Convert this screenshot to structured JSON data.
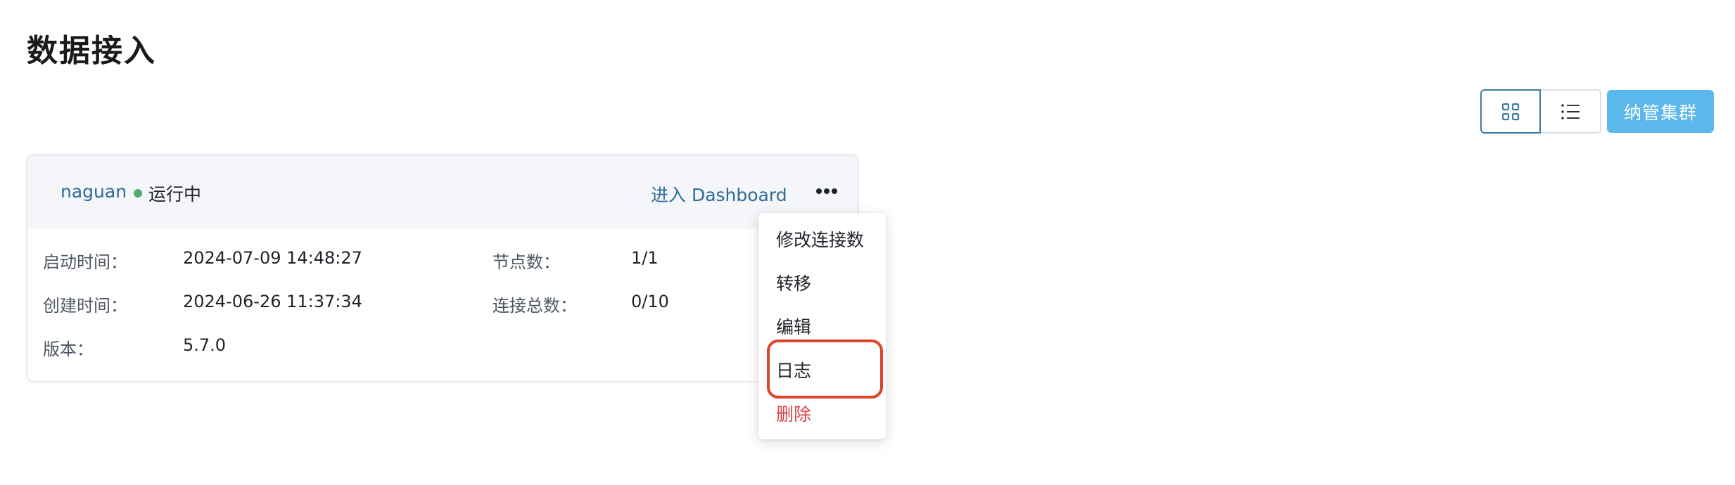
{
  "page": {
    "title": "数据接入"
  },
  "toolbar": {
    "grid_view": {
      "icon": "grid-icon"
    },
    "list_view": {
      "icon": "list-icon"
    },
    "primary_label": "纳管集群",
    "accent_color": "#5ab8ea"
  },
  "cluster": {
    "name": "naguan",
    "status": "运行中",
    "status_color": "#4caf6e",
    "dashboard_link": "进入 Dashboard",
    "more_icon": "more-horizontal-icon",
    "info": {
      "start_time_label": "启动时间：",
      "start_time": "2024-07-09 14:48:27",
      "created_label": "创建时间：",
      "created": "2024-06-26 11:37:34",
      "version_label": "版本：",
      "version": "5.7.0",
      "nodes_label": "节点数：",
      "nodes": "1/1",
      "connections_label": "连接总数：",
      "connections": "0/10"
    }
  },
  "menu": {
    "items": [
      {
        "label": "修改连接数"
      },
      {
        "label": "转移"
      },
      {
        "label": "编辑"
      },
      {
        "label": "日志"
      },
      {
        "label": "删除",
        "color": "#d64545"
      }
    ],
    "highlight_color": "#e0442b"
  }
}
